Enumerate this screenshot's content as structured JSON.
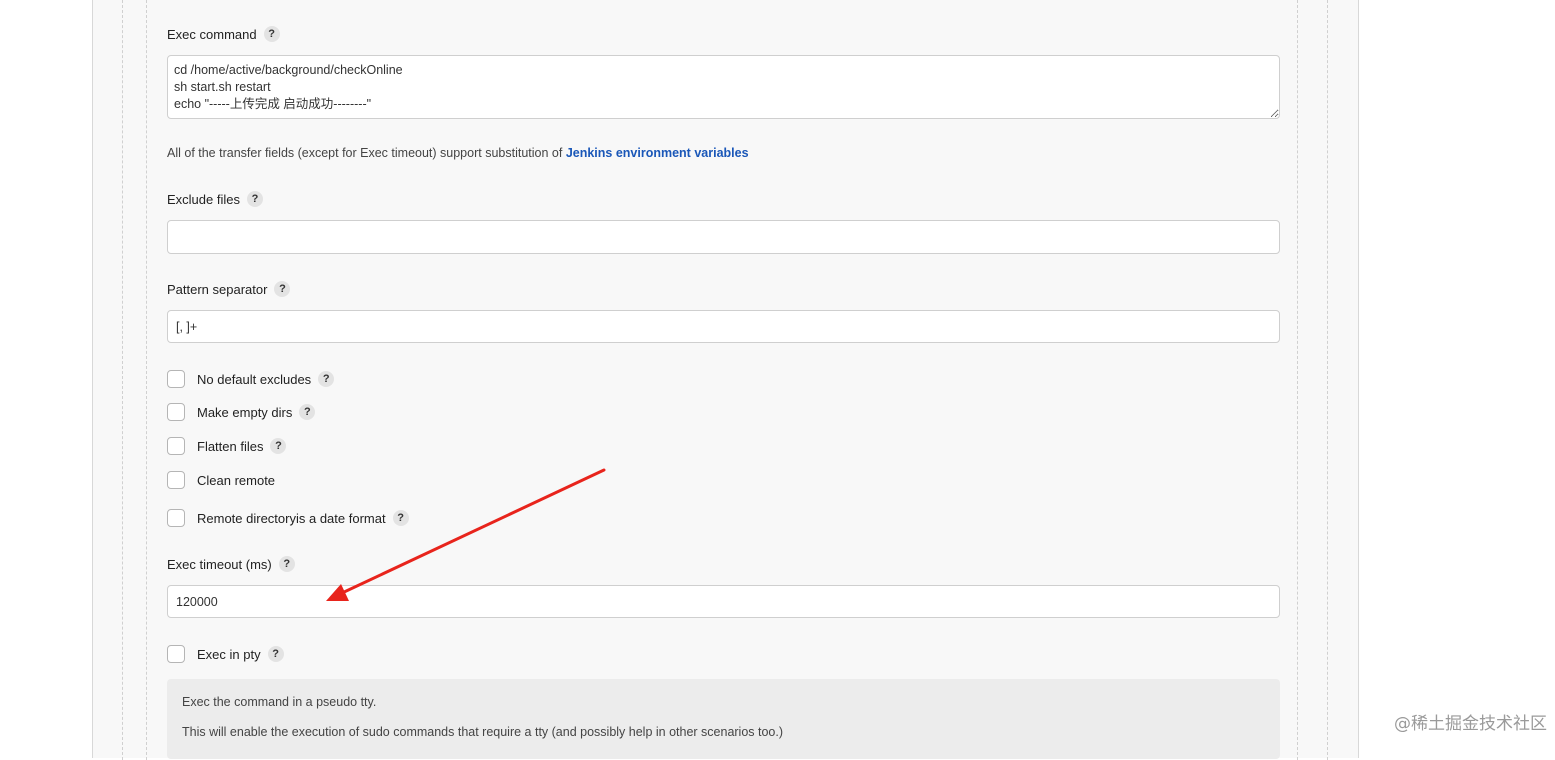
{
  "exec_command": {
    "label": "Exec command",
    "value": "cd /home/active/background/checkOnline\nsh start.sh restart\necho \"-----上传完成 启动成功--------\""
  },
  "note": {
    "text": "All of the transfer fields (except for Exec timeout) support substitution of ",
    "link": "Jenkins environment variables"
  },
  "exclude_files": {
    "label": "Exclude files",
    "value": ""
  },
  "pattern_separator": {
    "label": "Pattern separator",
    "value": "[, ]+"
  },
  "checkboxes": [
    {
      "label": "No default excludes",
      "checked": false
    },
    {
      "label": "Make empty dirs",
      "checked": false
    },
    {
      "label": "Flatten files",
      "checked": false
    },
    {
      "label": "Clean remote",
      "checked": false
    },
    {
      "label": "Remote directoryis a date format",
      "checked": false
    }
  ],
  "exec_timeout": {
    "label": "Exec timeout (ms)",
    "value": "120000"
  },
  "exec_in_pty": {
    "label": "Exec in pty",
    "checked": false,
    "help_lines": [
      "Exec the command in a pseudo tty.",
      "This will enable the execution of sudo commands that require a tty (and possibly help in other scenarios too.)"
    ]
  },
  "help_glyph": "?",
  "accent_color": "#e8241c",
  "link_color": "#1a57b8",
  "watermark": "@稀土掘金技术社区"
}
